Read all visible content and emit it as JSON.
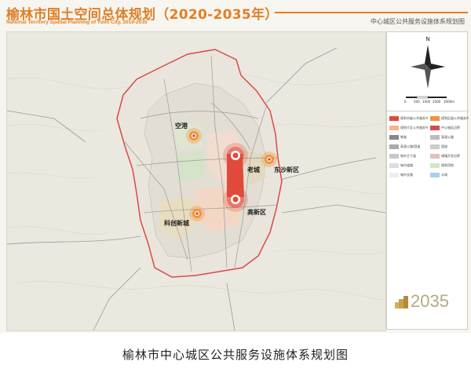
{
  "header": {
    "title": "榆林市国土空间总体规划（2020-2035年）",
    "subtitle": "National Territory Spatial Planning of Yulin City, 2019-2035",
    "map_name": "中心城区公共服务设施体系规划图"
  },
  "map": {
    "compass_north": "N",
    "scale_ticks": [
      "0",
      "500",
      "1000",
      "2000",
      "3000m"
    ],
    "districts": [
      {
        "label": "空港"
      },
      {
        "label": "老城"
      },
      {
        "label": "东沙新区"
      },
      {
        "label": "高新区"
      },
      {
        "label": "科创新城"
      }
    ]
  },
  "legend": {
    "items": [
      {
        "label": "规划市级公共服务中心",
        "color": "#e14a3a"
      },
      {
        "label": "规划区级公共服务中心",
        "color": "#f0943c"
      },
      {
        "label": "规划片区公共服务中心",
        "color": "#f7b48a"
      },
      {
        "label": "中心城区边界",
        "color": "#d84a4a"
      },
      {
        "label": "铁路",
        "color": "#888888"
      },
      {
        "label": "高速公路",
        "color": "#bbbbbb"
      },
      {
        "label": "高速公路/国道",
        "color": "#aaaaaa"
      },
      {
        "label": "国道",
        "color": "#cccccc"
      },
      {
        "label": "城市主干道",
        "color": "#c8c8c8"
      },
      {
        "label": "城镇开发边界",
        "color": "#e0c0c0"
      },
      {
        "label": "城市道路",
        "color": "#dddddd"
      },
      {
        "label": "规划用地",
        "color": "#d0e8c0"
      },
      {
        "label": "城市支路",
        "color": "#eeeeee"
      },
      {
        "label": "水域",
        "color": "#a8d0e8"
      }
    ]
  },
  "logo": {
    "text": "2035"
  },
  "caption": "榆林市中心城区公共服务设施体系规划图",
  "colors": {
    "accent": "#e07f26",
    "center": "#e14a3a",
    "boundary": "#d84a4a"
  }
}
